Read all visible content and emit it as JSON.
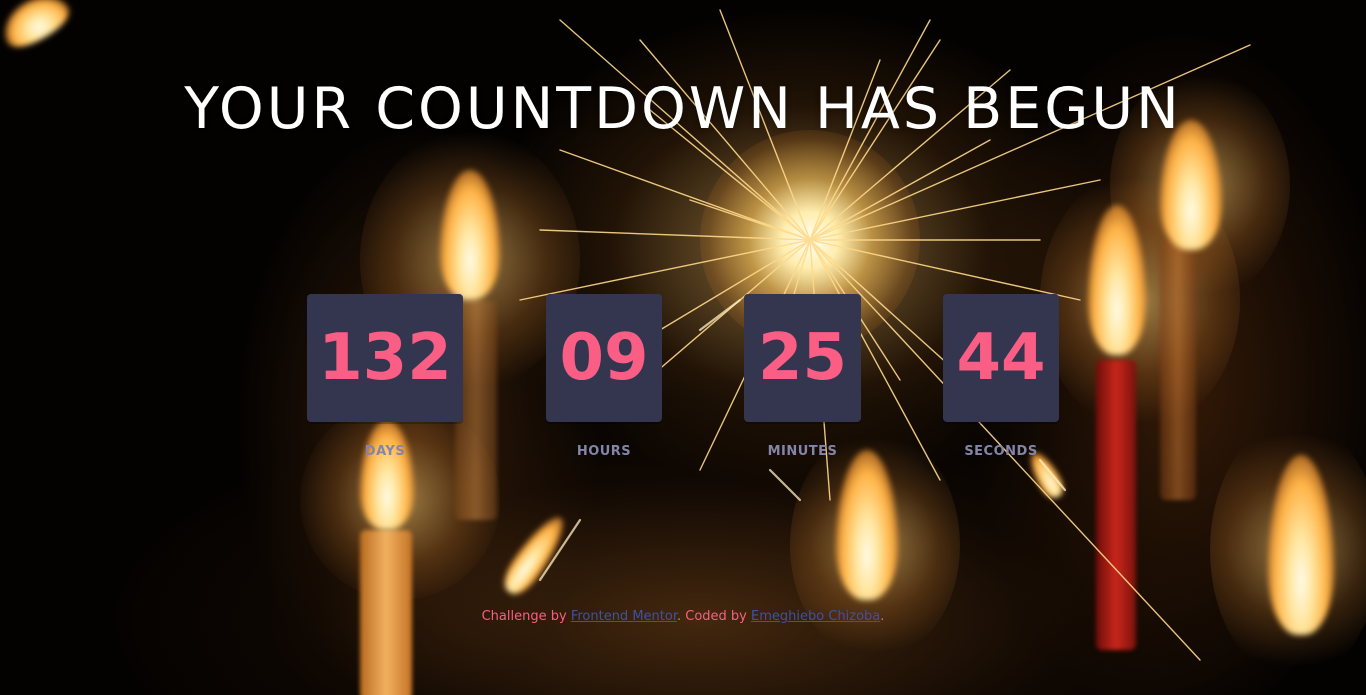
{
  "page": {
    "title": "YOUR COUNTDOWN HAS BEGUN"
  },
  "countdown": {
    "units": [
      {
        "value": "132",
        "label": "DAYS"
      },
      {
        "value": "09",
        "label": "HOURS"
      },
      {
        "value": "25",
        "label": "MINUTES"
      },
      {
        "value": "44",
        "label": "SECONDS"
      }
    ]
  },
  "footer": {
    "prefix": "Challenge by ",
    "link1": "Frontend Mentor",
    "middle": ". Coded by ",
    "link2": "Emeghiebo Chizoba",
    "suffix": "."
  },
  "colors": {
    "accent": "#fb5e84",
    "box": "#343650",
    "label": "#8385a9",
    "link": "#3e52a3",
    "title": "#ffffff"
  }
}
